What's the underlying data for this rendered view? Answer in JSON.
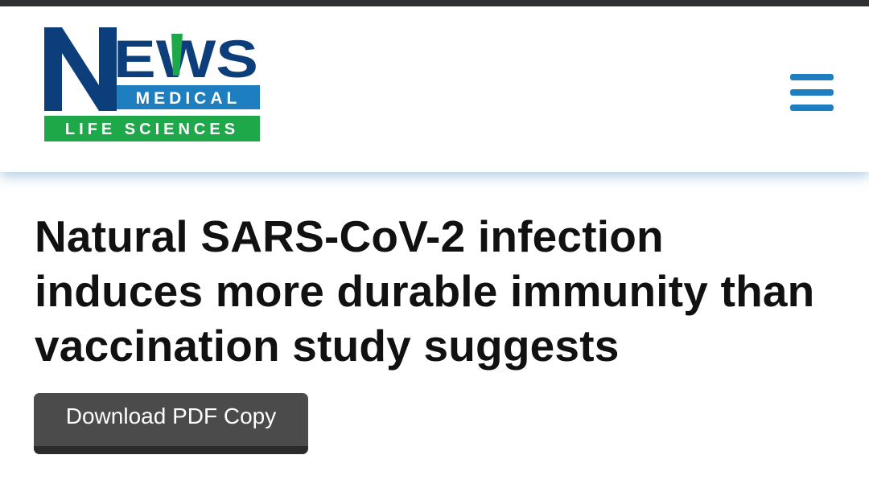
{
  "header": {
    "logo": {
      "big_text": "NEWS",
      "sub_text": "MEDICAL",
      "band_text": "LIFE SCIENCES"
    },
    "menu_icon": "hamburger-menu-icon"
  },
  "article": {
    "title": "Natural SARS-CoV-2 infection induces more durable immunity than vaccination study suggests",
    "download_label": "Download PDF Copy"
  },
  "colors": {
    "logo_navy": "#0b3e7a",
    "logo_blue": "#1e7fc0",
    "logo_green": "#1ea84a",
    "menu_blue": "#1e7fc0",
    "button_gray": "#4b4b4b",
    "title_text": "#111111"
  }
}
